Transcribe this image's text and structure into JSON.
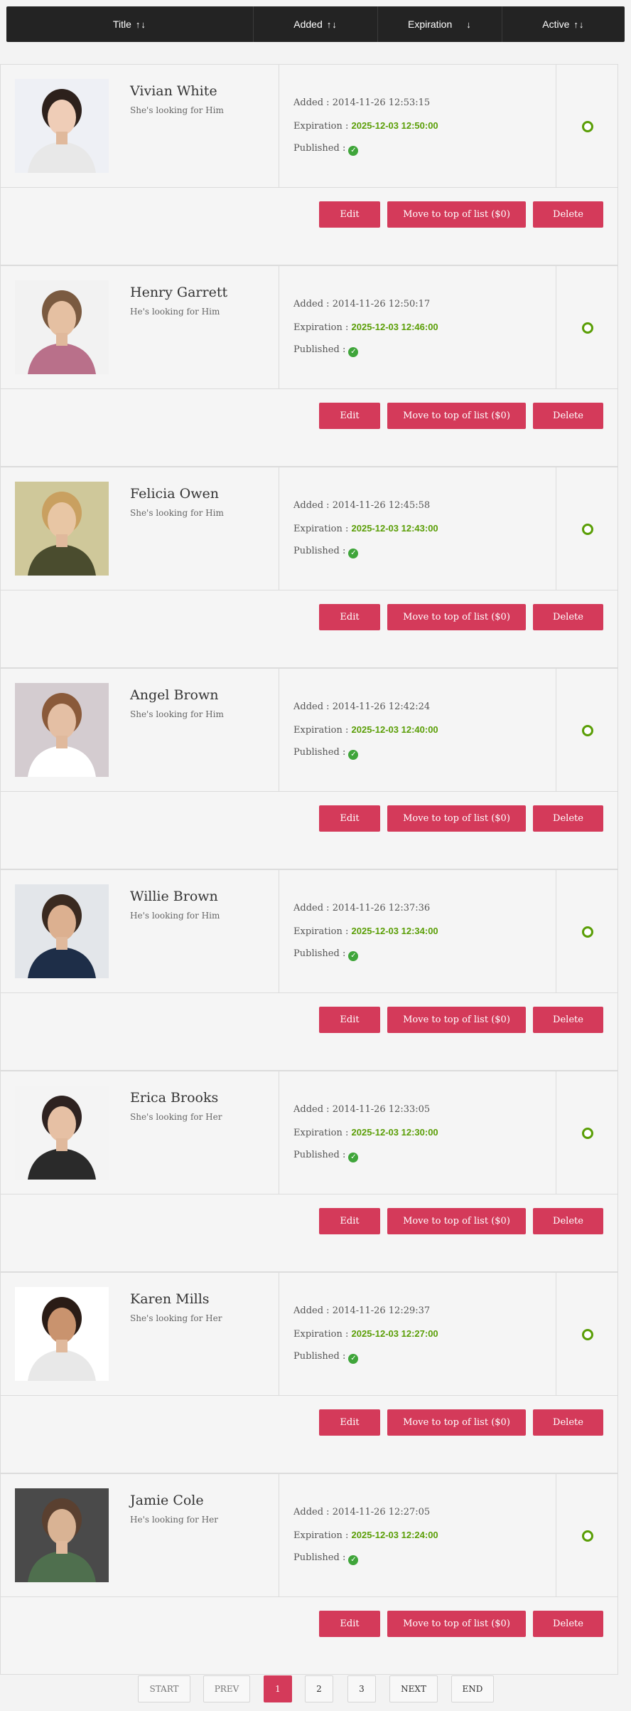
{
  "header": {
    "columns": [
      {
        "label": "Title",
        "arrows": "↑↓"
      },
      {
        "label": "Added",
        "arrows": "↑↓"
      },
      {
        "label": "Expiration",
        "arrows": "↓"
      },
      {
        "label": "Active",
        "arrows": "↑↓"
      }
    ]
  },
  "labels": {
    "added": "Added : ",
    "expiration": "Expiration : ",
    "published": "Published : ",
    "edit": "Edit",
    "move": "Move to top of list ($0)",
    "delete": "Delete"
  },
  "colors": {
    "accent": "#d43a5a",
    "expiration": "#5a9e06",
    "header": "#232323",
    "published": "#3fa53a"
  },
  "listings": [
    {
      "name": "Vivian White",
      "subtitle": "She's looking for Him",
      "added": "2014-11-26 12:53:15",
      "expiration": "2025-12-03 12:50:00",
      "published": true,
      "active": true
    },
    {
      "name": "Henry Garrett",
      "subtitle": "He's looking for Him",
      "added": "2014-11-26 12:50:17",
      "expiration": "2025-12-03 12:46:00",
      "published": true,
      "active": true
    },
    {
      "name": "Felicia Owen",
      "subtitle": "She's looking for Him",
      "added": "2014-11-26 12:45:58",
      "expiration": "2025-12-03 12:43:00",
      "published": true,
      "active": true
    },
    {
      "name": "Angel Brown",
      "subtitle": "She's looking for Him",
      "added": "2014-11-26 12:42:24",
      "expiration": "2025-12-03 12:40:00",
      "published": true,
      "active": true
    },
    {
      "name": "Willie Brown",
      "subtitle": "He's looking for Him",
      "added": "2014-11-26 12:37:36",
      "expiration": "2025-12-03 12:34:00",
      "published": true,
      "active": true
    },
    {
      "name": "Erica Brooks",
      "subtitle": "She's looking for Her",
      "added": "2014-11-26 12:33:05",
      "expiration": "2025-12-03 12:30:00",
      "published": true,
      "active": true
    },
    {
      "name": "Karen Mills",
      "subtitle": "She's looking for Her",
      "added": "2014-11-26 12:29:37",
      "expiration": "2025-12-03 12:27:00",
      "published": true,
      "active": true
    },
    {
      "name": "Jamie Cole",
      "subtitle": "He's looking for Her",
      "added": "2014-11-26 12:27:05",
      "expiration": "2025-12-03 12:24:00",
      "published": true,
      "active": true
    }
  ],
  "pagination": {
    "start": "START",
    "prev": "PREV",
    "pages": [
      "1",
      "2",
      "3"
    ],
    "current": "1",
    "next": "NEXT",
    "end": "END"
  }
}
